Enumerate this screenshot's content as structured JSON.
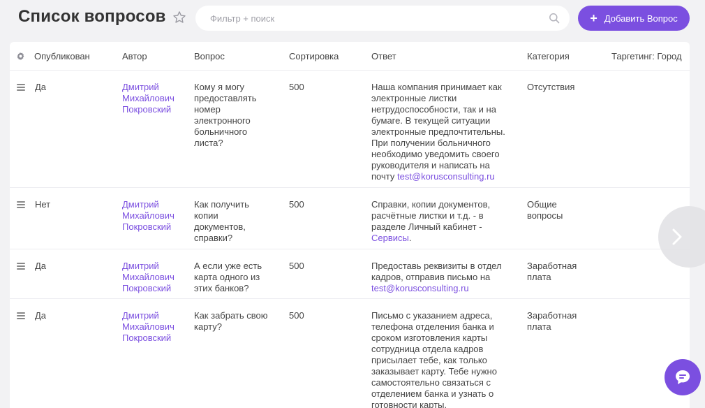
{
  "header": {
    "title": "Список вопросов",
    "search_placeholder": "Фильтр + поиск",
    "search_value": "",
    "add_button_label": "Добавить Вопрос"
  },
  "table": {
    "columns": {
      "published": "Опубликован",
      "author": "Автор",
      "question": "Вопрос",
      "sort": "Сортировка",
      "answer": "Ответ",
      "category": "Категория",
      "targeting": "Таргетинг: Город"
    },
    "rows": [
      {
        "published": "Да",
        "author": "Дмитрий Михайлович Покровский",
        "question": "Кому я могу предоставлять номер электронного больничного листа?",
        "sort": "500",
        "answer_text": "Наша компания принимает как электронные листки нетрудоспособности, так и на бумаге. В текущей ситуации электронные предпочтительны. При получении больничного необходимо уведомить своего руководителя и написать на почту",
        "answer_link": "test@korusconsulting.ru",
        "category": "Отсутствия"
      },
      {
        "published": "Нет",
        "author": "Дмитрий Михайлович Покровский",
        "question": "Как получить копии документов, справки?",
        "sort": "500",
        "answer_text": "Справки, копии документов, расчётные листки и т.д. - в разделе Личный кабинет -",
        "answer_link": "Сервисы",
        "answer_tail": ".",
        "category": "Общие вопросы"
      },
      {
        "published": "Да",
        "author": "Дмитрий Михайлович Покровский",
        "question": "А если уже есть карта одного из этих банков?",
        "sort": "500",
        "answer_text": "Предоставь реквизиты в отдел кадров, отправив письмо на",
        "answer_link": "test@korusconsulting.ru",
        "category": "Заработная плата"
      },
      {
        "published": "Да",
        "author": "Дмитрий Михайлович Покровский",
        "question": "Как забрать свою карту?",
        "sort": "500",
        "answer_text": "Письмо с указанием адреса, телефона отделения банка и сроком изготовления карты сотрудница отдела кадров присылает тебе, как только заказывает карту. Тебе нужно самостоятельно связаться с отделением банка и узнать о готовности карты.",
        "category": "Заработная плата"
      }
    ]
  },
  "icons": {
    "star": "star-outline-icon",
    "search": "magnifier-icon",
    "gear": "gear-icon",
    "drag": "drag-handle-icon",
    "next": "chevron-right-icon",
    "chat": "chat-bubble-icon"
  },
  "colors": {
    "accent": "#7b4fe0",
    "background": "#f2f2f4",
    "card": "#ffffff"
  }
}
